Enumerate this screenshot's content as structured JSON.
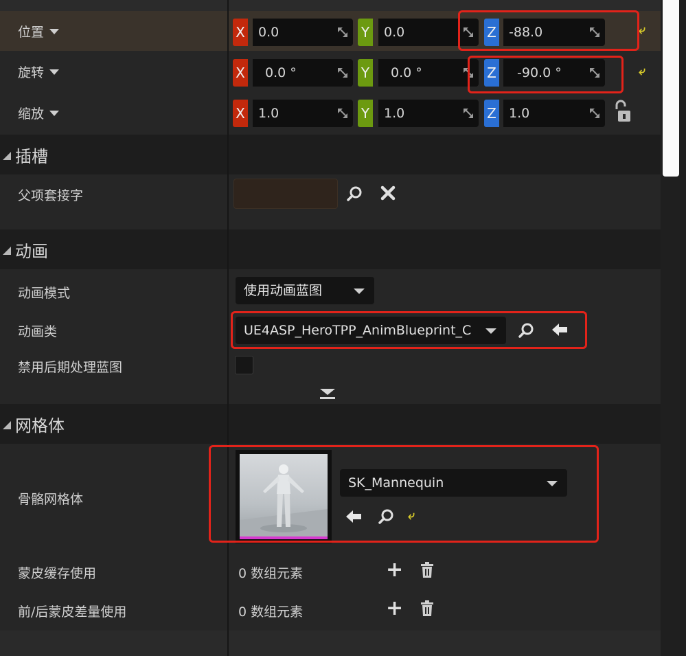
{
  "transform": {
    "location": {
      "label": "位置",
      "x": "0.0",
      "y": "0.0",
      "z": "-88.0"
    },
    "rotation": {
      "label": "旋转",
      "x": "0.0 °",
      "y": "0.0 °",
      "z": "-90.0 °"
    },
    "scale": {
      "label": "缩放",
      "x": "1.0",
      "y": "1.0",
      "z": "1.0"
    },
    "axis_labels": {
      "x": "X",
      "y": "Y",
      "z": "Z"
    }
  },
  "sockets": {
    "title": "插槽",
    "parent_socket_label": "父项套接字",
    "parent_socket_value": ""
  },
  "animation": {
    "title": "动画",
    "mode_label": "动画模式",
    "mode_value": "使用动画蓝图",
    "class_label": "动画类",
    "class_value": "UE4ASP_HeroTPP_AnimBlueprint_C",
    "disable_post_process_label": "禁用后期处理蓝图",
    "disable_post_process_checked": false
  },
  "mesh": {
    "title": "网格体",
    "skeletal_mesh_label": "骨骼网格体",
    "skeletal_mesh_value": "SK_Mannequin",
    "skin_cache_label": "蒙皮缓存使用",
    "skin_cache_value": "0 数组元素",
    "morph_label": "前/后蒙皮差量使用",
    "morph_value": "0 数组元素"
  },
  "colors": {
    "axis_x": "#c3290c",
    "axis_y": "#6c9a10",
    "axis_z": "#2a6fd4",
    "highlight_box": "#e2231a",
    "reset_arrow": "#d6c92a"
  }
}
